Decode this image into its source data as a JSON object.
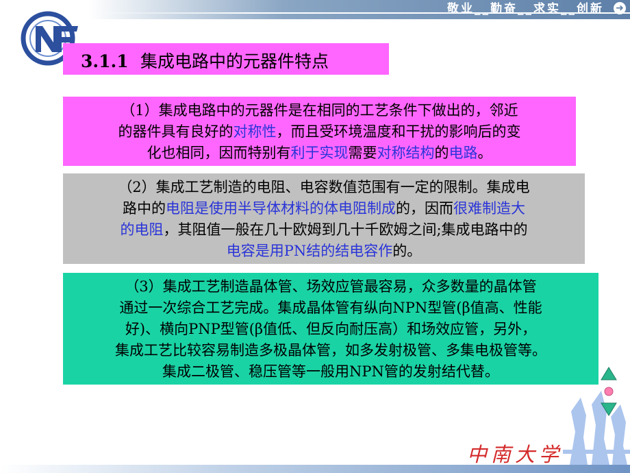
{
  "header": {
    "motto": "敬业__勤奋__求实__创新",
    "back_icon": "back-arrow-icon"
  },
  "slide": {
    "section_number": "3.1.1",
    "title": "集成电路中的元器件特点"
  },
  "paragraphs": [
    {
      "lines": [
        [
          {
            "t": "（1）集成电路中的元器件是在相同的工艺条件下做出的，邻近",
            "hl": false
          }
        ],
        [
          {
            "t": "的器件具有良好的",
            "hl": false
          },
          {
            "t": "对称性",
            "hl": true
          },
          {
            "t": "，而且受环境温度和干扰的影响后的变",
            "hl": false
          }
        ],
        [
          {
            "t": "化也相同，因而特别有",
            "hl": false
          },
          {
            "t": "利于实现",
            "hl": true
          },
          {
            "t": "需要",
            "hl": false
          },
          {
            "t": "对称结构",
            "hl": true
          },
          {
            "t": "的",
            "hl": false
          },
          {
            "t": "电路",
            "hl": true
          },
          {
            "t": "。",
            "hl": false
          }
        ]
      ]
    },
    {
      "lines": [
        [
          {
            "t": "（2）集成工艺制造的电阻、电容数值范围有一定的限制。集成电",
            "hl": false
          }
        ],
        [
          {
            "t": "路中的",
            "hl": false
          },
          {
            "t": "电阻是使用半导体材料的体电阻制成",
            "hl": true
          },
          {
            "t": "的，因而",
            "hl": false
          },
          {
            "t": "很难制造大",
            "hl": true
          }
        ],
        [
          {
            "t": "的电阻",
            "hl": true
          },
          {
            "t": "，其阻值一般在几十欧姆到几十千欧姆之间;集成电路中的",
            "hl": false
          }
        ],
        [
          {
            "t": "电容是用PN结的结电容作",
            "hl": true
          },
          {
            "t": "的。",
            "hl": false
          }
        ]
      ]
    },
    {
      "lines": [
        [
          {
            "t": "（3）集成工艺制造晶体管、场效应管最容易，众多数量的晶体管",
            "hl": false
          }
        ],
        [
          {
            "t": "通过一次综合工艺完成。集成晶体管有纵向NPN型管(β值高、性能",
            "hl": false
          }
        ],
        [
          {
            "t": "好)、横向PNP型管(β值低、但反向耐压高）和场效应管，另外，",
            "hl": false
          }
        ],
        [
          {
            "t": "集成工艺比较容易制造多极晶体管，如多发射极管、多集电极管等。",
            "hl": false
          }
        ],
        [
          {
            "t": "集成二极管、稳压管等一般用NPN管的发射结代替。",
            "hl": false
          }
        ]
      ]
    }
  ],
  "footer": {
    "university": "中南大学",
    "nav_up_icon": "triangle-up-icon",
    "nav_home_icon": "circle-home-icon",
    "nav_down_icon": "triangle-down-icon"
  },
  "colors": {
    "title_bg": "#ff66ff",
    "para1_bg": "#ff66ff",
    "para2_bg": "#c0c0c0",
    "para3_bg": "#1ad3a5",
    "highlight_text": "#2a34d8",
    "university_text": "#d42a2a"
  }
}
